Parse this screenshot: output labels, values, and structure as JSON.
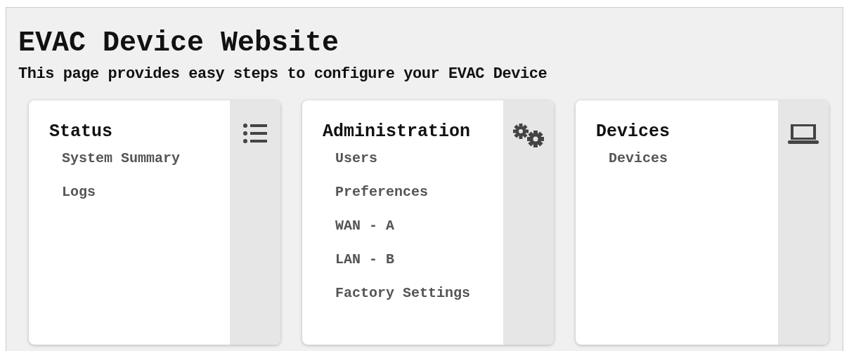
{
  "title": "EVAC Device Website",
  "subtitle": "This page provides easy steps to configure your EVAC Device",
  "cards": [
    {
      "title": "Status",
      "kind": "list",
      "items": [
        "System Summary",
        "Logs"
      ]
    },
    {
      "title": "Administration",
      "kind": "gears",
      "items": [
        "Users",
        "Preferences",
        "WAN - A",
        "LAN - B",
        "Factory Settings"
      ]
    },
    {
      "title": "Devices",
      "kind": "laptop",
      "items": [
        "Devices"
      ]
    }
  ]
}
